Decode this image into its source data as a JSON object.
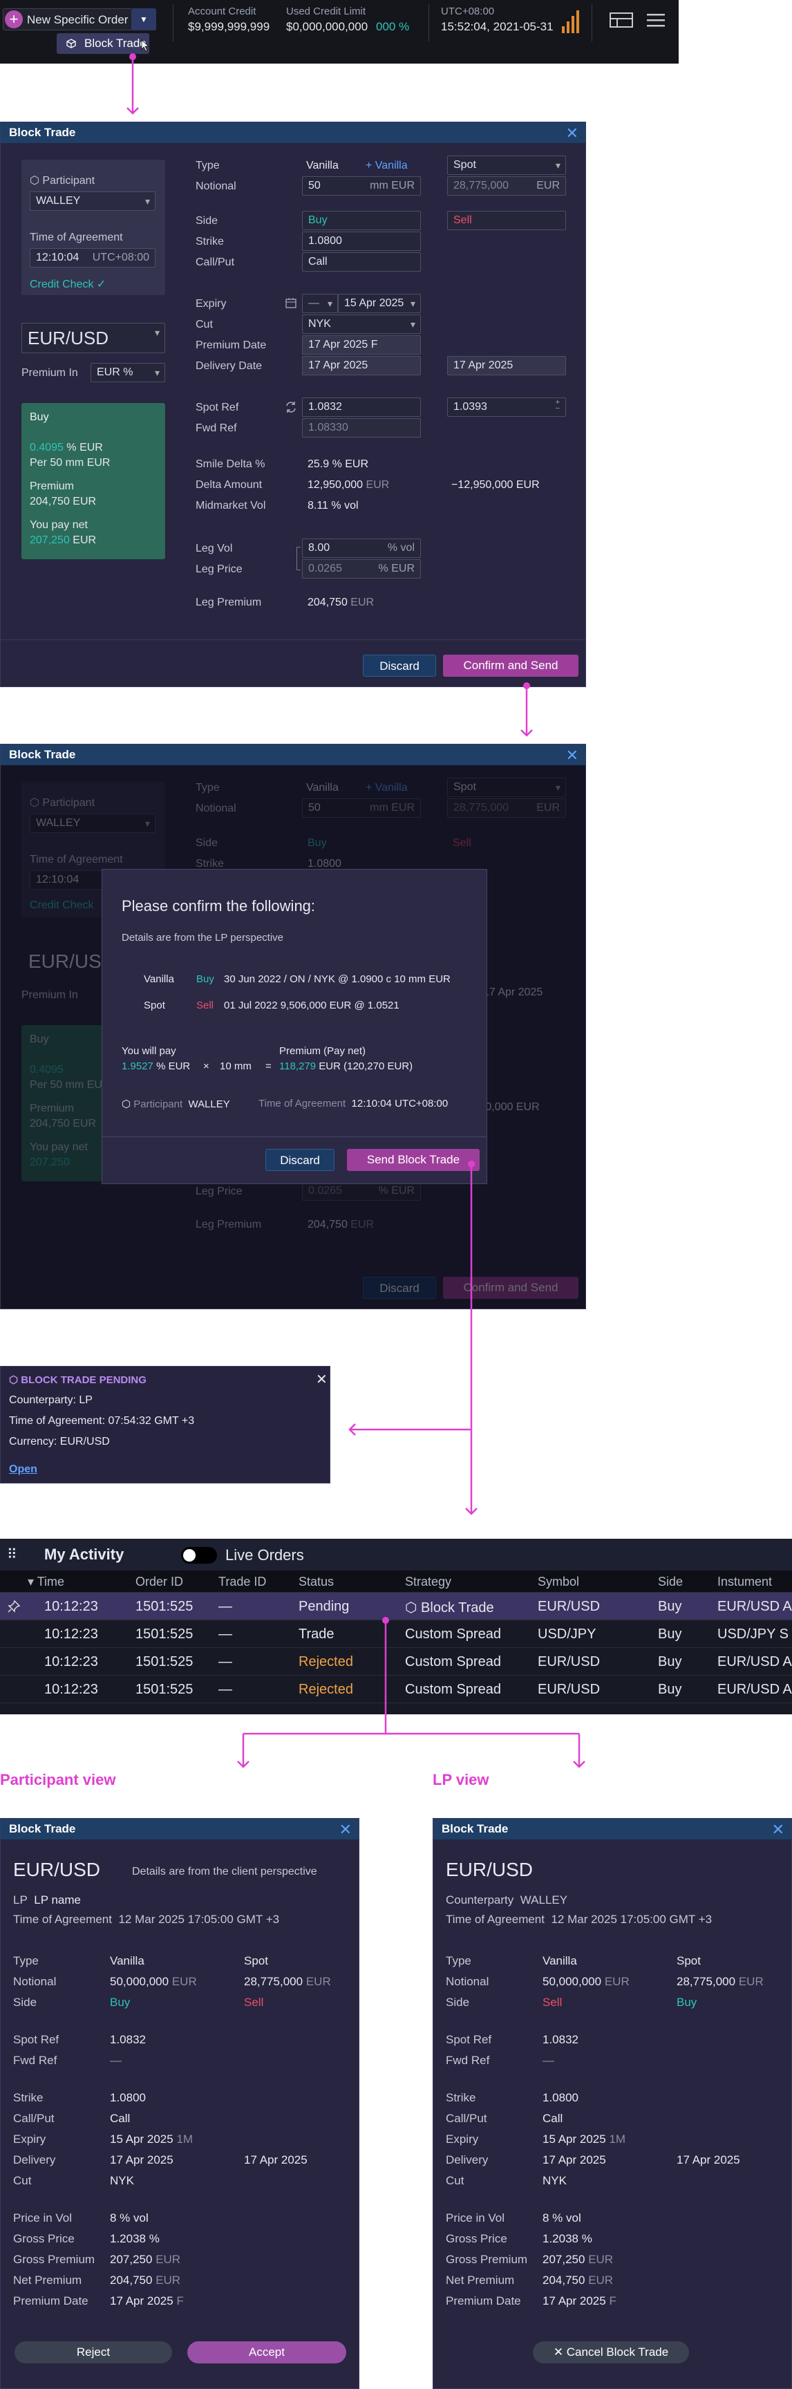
{
  "topbar": {
    "new_order": "New Specific Order",
    "menu_item": "Block Trade",
    "account_credit_label": "Account Credit",
    "account_credit_value": "$9,999,999,999",
    "used_credit_label": "Used Credit Limit",
    "used_credit_value": "$0,000,000,000",
    "used_credit_pct": "000 %",
    "tz": "UTC+08:00",
    "clock": "15:52:04, 2021-05-31"
  },
  "block": {
    "title": "Block Trade",
    "participant_label": "Participant",
    "participant": "WALLEY",
    "toa_label": "Time of Agreement",
    "toa_time": "12:10:04",
    "toa_tz": "UTC+08:00",
    "credit_check": "Credit Check",
    "pair": "EUR/USD",
    "premium_in_label": "Premium In",
    "premium_in": "EUR %",
    "summary": {
      "side": "Buy",
      "rate": "0.4095",
      "rate_unit": "% EUR",
      "per": "Per 50 mm EUR",
      "premium_label": "Premium",
      "premium": "204,750 EUR",
      "pay_label": "You pay net",
      "pay": "207,250",
      "pay_unit": "EUR"
    },
    "type_label": "Type",
    "type_val": "Vanilla",
    "add_vanilla": "+ Vanilla",
    "spot": "Spot",
    "notional_label": "Notional",
    "notional": "50",
    "notional_unit": "mm EUR",
    "notional2": "28,775,000",
    "notional2_unit": "EUR",
    "side_label": "Side",
    "side1": "Buy",
    "side2": "Sell",
    "strike_label": "Strike",
    "strike": "1.0800",
    "cp_label": "Call/Put",
    "cp": "Call",
    "expiry_label": "Expiry",
    "expiry_tenor": "—",
    "expiry": "15 Apr 2025",
    "cut_label": "Cut",
    "cut": "NYK",
    "pdate_label": "Premium Date",
    "pdate": "17 Apr 2025 F",
    "ddate_label": "Delivery Date",
    "ddate": "17 Apr 2025",
    "ddate2": "17 Apr 2025",
    "spotref_label": "Spot Ref",
    "spotref": "1.0832",
    "spotref2": "1.0393",
    "fwdref_label": "Fwd Ref",
    "fwdref": "1.08330",
    "smile_label": "Smile Delta %",
    "smile": "25.9 % EUR",
    "delta_label": "Delta Amount",
    "delta": "12,950,000",
    "delta_unit": "EUR",
    "delta2": "−12,950,000 EUR",
    "mid_label": "Midmarket Vol",
    "mid": "8.11 % vol",
    "legvol_label": "Leg Vol",
    "legvol": "8.00",
    "legvol_unit": "% vol",
    "legprice_label": "Leg Price",
    "legprice": "0.0265",
    "legprice_unit": "% EUR",
    "legprem_label": "Leg Premium",
    "legprem": "204,750",
    "legprem_unit": "EUR",
    "discard": "Discard",
    "confirm": "Confirm and Send"
  },
  "confirm": {
    "title": "Please confirm the following:",
    "sub": "Details are from the LP perspective",
    "l1_type": "Vanilla",
    "l1_side": "Buy",
    "l1_text": "30 Jun 2022 / ON / NYK  @ 1.0900 c 10 mm EUR",
    "l2_type": "Spot",
    "l2_side": "Sell",
    "l2_text": "01 Jul 2022 9,506,000 EUR @ 1.0521",
    "pay_label": "You will pay",
    "pay_rate": "1.9527",
    "pay_rate_unit": "% EUR",
    "times": "×",
    "mm": "10 mm",
    "eq": "=",
    "prem_label": "Premium (Pay net)",
    "prem": "118,279",
    "prem_rest": "EUR (120,270 EUR)",
    "part_label": "Participant",
    "part": "WALLEY",
    "toa_label": "Time of Agreement",
    "toa": "12:10:04 UTC+08:00",
    "discard": "Discard",
    "send": "Send Block Trade"
  },
  "notif": {
    "title": "BLOCK TRADE PENDING",
    "cp": "Counterparty: LP",
    "toa": "Time of Agreement: 07:54:32 GMT +3",
    "ccy": "Currency: EUR/USD",
    "open": "Open"
  },
  "activity": {
    "title": "My Activity",
    "live": "Live Orders",
    "cols": [
      "Time",
      "Order ID",
      "Trade ID",
      "Status",
      "Strategy",
      "Symbol",
      "Side",
      "Instument"
    ],
    "rows": [
      [
        "10:12:23",
        "1501:525",
        "—",
        "Pending",
        "Block Trade",
        "EUR/USD",
        "Buy",
        "EUR/USD A"
      ],
      [
        "10:12:23",
        "1501:525",
        "—",
        "Trade",
        "Custom Spread",
        "USD/JPY",
        "Buy",
        "USD/JPY S"
      ],
      [
        "10:12:23",
        "1501:525",
        "—",
        "Rejected",
        "Custom Spread",
        "EUR/USD",
        "Buy",
        "EUR/USD A"
      ],
      [
        "10:12:23",
        "1501:525",
        "—",
        "Rejected",
        "Custom Spread",
        "EUR/USD",
        "Buy",
        "EUR/USD A"
      ]
    ]
  },
  "views": {
    "participant_view": "Participant view",
    "lp_view": "LP view"
  },
  "pv": {
    "title": "Block Trade",
    "pair": "EUR/USD",
    "note": "Details are from the client perspective",
    "lp_label": "LP",
    "lp": "LP name",
    "toa_label": "Time of Agreement",
    "toa": "12 Mar 2025  17:05:00  GMT +3",
    "type_label": "Type",
    "type1": "Vanilla",
    "type2": "Spot",
    "not_label": "Notional",
    "not1": "50,000,000",
    "not1_u": "EUR",
    "not2": "28,775,000",
    "not2_u": "EUR",
    "side_label": "Side",
    "side1": "Buy",
    "side2": "Sell",
    "spot_label": "Spot Ref",
    "spot": "1.0832",
    "fwd_label": "Fwd Ref",
    "fwd": "—",
    "strike_label": "Strike",
    "strike": "1.0800",
    "cp_label": "Call/Put",
    "cp": "Call",
    "exp_label": "Expiry",
    "exp": "15 Apr 2025",
    "exp_t": "1M",
    "del_label": "Delivery",
    "del1": "17 Apr 2025",
    "del2": "17 Apr 2025",
    "cut_label": "Cut",
    "cut": "NYK",
    "piv_label": "Price in Vol",
    "piv": "8 % vol",
    "gp_label": "Gross Price",
    "gp": "1.2038 %",
    "gprem_label": "Gross Premium",
    "gprem": "207,250",
    "gprem_u": "EUR",
    "nprem_label": "Net Premium",
    "nprem": "204,750",
    "nprem_u": "EUR",
    "pd_label": "Premium Date",
    "pd": "17 Apr 2025",
    "pd_f": "F",
    "reject": "Reject",
    "accept": "Accept"
  },
  "lv": {
    "title": "Block Trade",
    "pair": "EUR/USD",
    "cp_label": "Counterparty",
    "cp_name": "WALLEY",
    "toa_label": "Time of Agreement",
    "toa": "12 Mar 2025  17:05:00  GMT +3",
    "side1": "Sell",
    "side2": "Buy",
    "cancel": "Cancel Block Trade"
  },
  "colors": {
    "accent": "#b34fb0",
    "buy": "#2ec4b6",
    "sell": "#ef4f6a",
    "connector": "#e040d0"
  }
}
